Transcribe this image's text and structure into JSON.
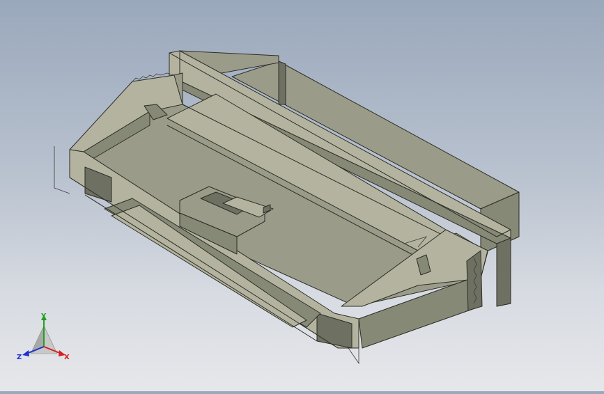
{
  "viewport": {
    "background_top": "#9aa8bc",
    "background_bottom": "#e6e7ea",
    "model_colors": {
      "face_top": "#9a9b89",
      "face_light": "#b8b8a4",
      "face_mid": "#888a78",
      "face_dark": "#6f7163",
      "edge": "#2c2d25"
    }
  },
  "triad": {
    "x_label": "X",
    "y_label": "Y",
    "z_label": "Z",
    "x_color": "#d42020",
    "y_color": "#20a020",
    "z_color": "#2030d0"
  }
}
